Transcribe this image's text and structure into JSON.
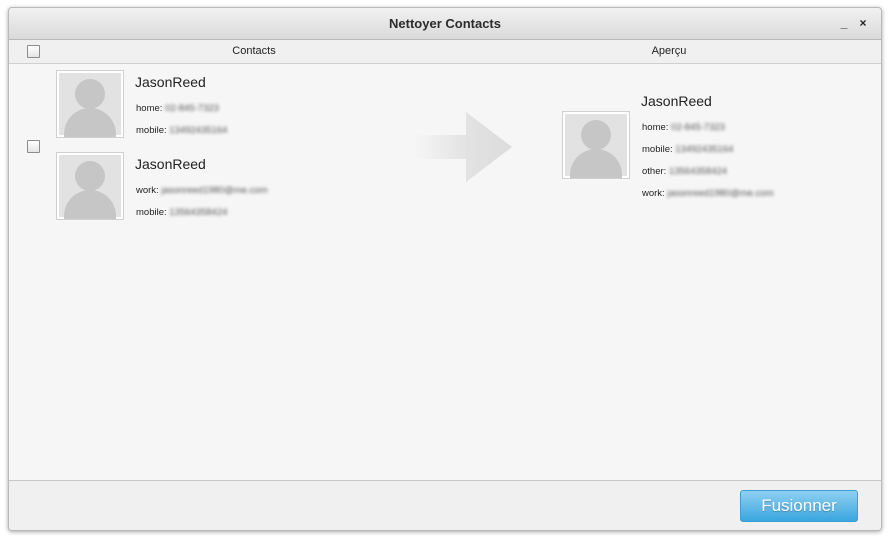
{
  "window": {
    "title": "Nettoyer Contacts",
    "minimize": "_",
    "close": "×"
  },
  "header": {
    "contacts": "Contacts",
    "preview": "Aperçu"
  },
  "contacts": [
    {
      "name": "JasonReed",
      "fields": [
        {
          "label": "home:",
          "value": "02-845-7323"
        },
        {
          "label": "mobile:",
          "value": "13492435164"
        }
      ]
    },
    {
      "name": "JasonReed",
      "fields": [
        {
          "label": "work:",
          "value": "jasonreed1980@me.com"
        },
        {
          "label": "mobile:",
          "value": "13564358424"
        }
      ]
    }
  ],
  "preview": {
    "name": "JasonReed",
    "fields": [
      {
        "label": "home:",
        "value": "02-845-7323"
      },
      {
        "label": "mobile:",
        "value": "13492435164"
      },
      {
        "label": "other:",
        "value": "13564358424"
      },
      {
        "label": "work:",
        "value": "jasonreed1980@me.com"
      }
    ]
  },
  "footer": {
    "merge_button": "Fusionner"
  },
  "colors": {
    "accent": "#3aa6df",
    "background": "#f6f6f6"
  }
}
